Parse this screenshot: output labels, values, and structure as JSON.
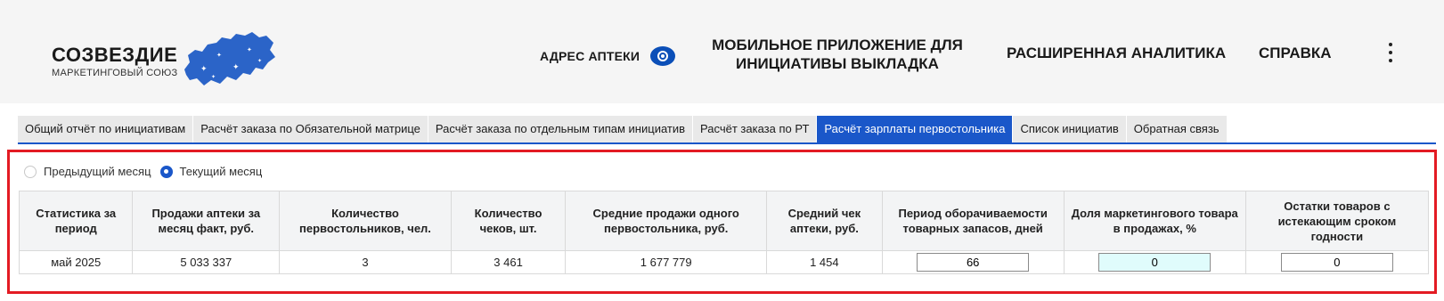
{
  "logo": {
    "title": "СОЗВЕЗДИЕ",
    "subtitle": "МАРКЕТИНГОВЫЙ СОЮЗ",
    "map_color": "#2b64c8"
  },
  "header": {
    "address_label": "АДРЕС АПТЕКИ",
    "address_icon": "eye-icon",
    "nav_mobile": [
      "МОБИЛЬНОЕ ПРИЛОЖЕНИЕ ДЛЯ",
      "ИНИЦИАТИВЫ ВЫКЛАДКА"
    ],
    "nav_analytics": "РАСШИРЕННАЯ АНАЛИТИКА",
    "nav_help": "СПРАВКА",
    "more_icon": "vertical-ellipsis-icon"
  },
  "tabs": [
    {
      "label": "Общий отчёт по инициативам",
      "active": false
    },
    {
      "label": "Расчёт заказа по Обязательной матрице",
      "active": false
    },
    {
      "label": "Расчёт заказа по отдельным типам инициатив",
      "active": false
    },
    {
      "label": "Расчёт заказа по РТ",
      "active": false
    },
    {
      "label": "Расчёт зарплаты первостольника",
      "active": true
    },
    {
      "label": "Список инициатив",
      "active": false
    },
    {
      "label": "Обратная связь",
      "active": false
    }
  ],
  "period": {
    "prev_label": "Предыдущий месяц",
    "current_label": "Текущий месяц",
    "selected": "current"
  },
  "table": {
    "headers": [
      "Статистика за период",
      "Продажи аптеки за месяц факт, руб.",
      "Количество первостольников, чел.",
      "Количество чеков, шт.",
      "Средние продажи одного первостольника, руб.",
      "Средний чек аптеки, руб.",
      "Период оборачиваемости товарных запасов, дней",
      "Доля маркетингового товара в продажах, %",
      "Остатки товаров с истекающим сроком годности"
    ],
    "row": {
      "period": "май 2025",
      "sales": "5 033 337",
      "staff_count": "3",
      "receipts": "3 461",
      "avg_sales_per_staff": "1 677 779",
      "avg_receipt": "1 454",
      "turnover_days": "66",
      "marketing_share": "0",
      "expiring_stock": "0"
    }
  },
  "colors": {
    "accent": "#1a57c9",
    "highlight_border": "#e31b23",
    "input_cyan": "#e0fcfc"
  }
}
